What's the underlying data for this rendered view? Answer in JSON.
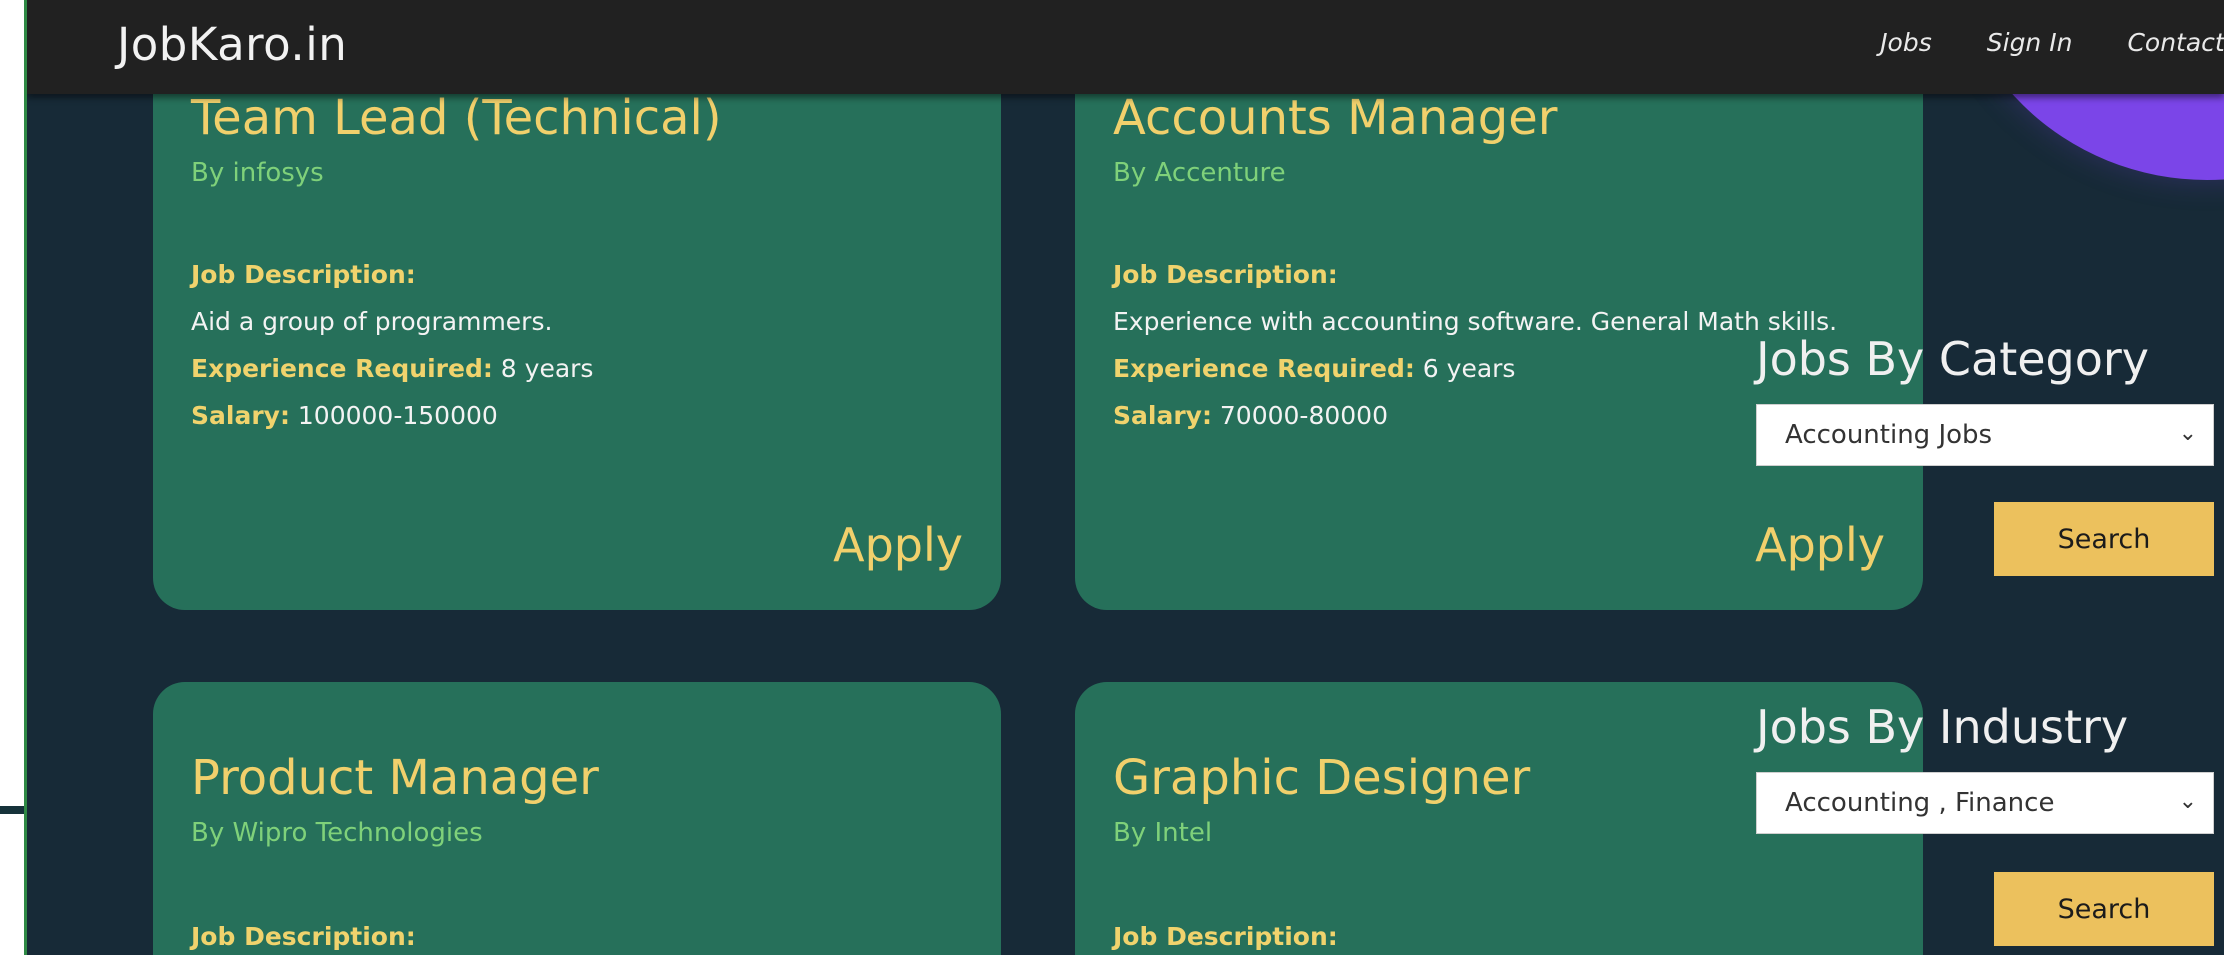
{
  "header": {
    "brand": "JobKaro.in",
    "nav": [
      "Jobs",
      "Sign In",
      "Contact Us"
    ]
  },
  "jobs": [
    {
      "title": "Team Lead (Technical)",
      "company": "By infosys",
      "desc_label": "Job Description:",
      "desc": "Aid a group of programmers.",
      "exp_label": "Experience Required:",
      "exp": "8 years",
      "salary_label": "Salary:",
      "salary": "100000-150000",
      "apply": "Apply"
    },
    {
      "title": "Accounts Manager",
      "company": "By Accenture",
      "desc_label": "Job Description:",
      "desc": "Experience with accounting software. General Math skills.",
      "exp_label": "Experience Required:",
      "exp": "6 years",
      "salary_label": "Salary:",
      "salary": "70000-80000",
      "apply": "Apply"
    },
    {
      "title": "Product Manager",
      "company": "By Wipro Technologies",
      "desc_label": "Job Description:"
    },
    {
      "title": "Graphic Designer",
      "company": "By Intel",
      "desc_label": "Job Description:"
    }
  ],
  "filters": {
    "category": {
      "title": "Jobs By Category",
      "selected": "Accounting Jobs",
      "button": "Search"
    },
    "industry": {
      "title": "Jobs By Industry",
      "selected": "Accounting , Finance",
      "button": "Search"
    }
  },
  "icons": {
    "dropdown": "chevron-down-icon"
  },
  "colors": {
    "background": "#172a37",
    "card": "#26705a",
    "accent_yellow": "#f1d06c",
    "company_green": "#7fd17a",
    "button_yellow": "#ecc15d",
    "header": "#212121",
    "blob_purple": "#7b45e8"
  }
}
